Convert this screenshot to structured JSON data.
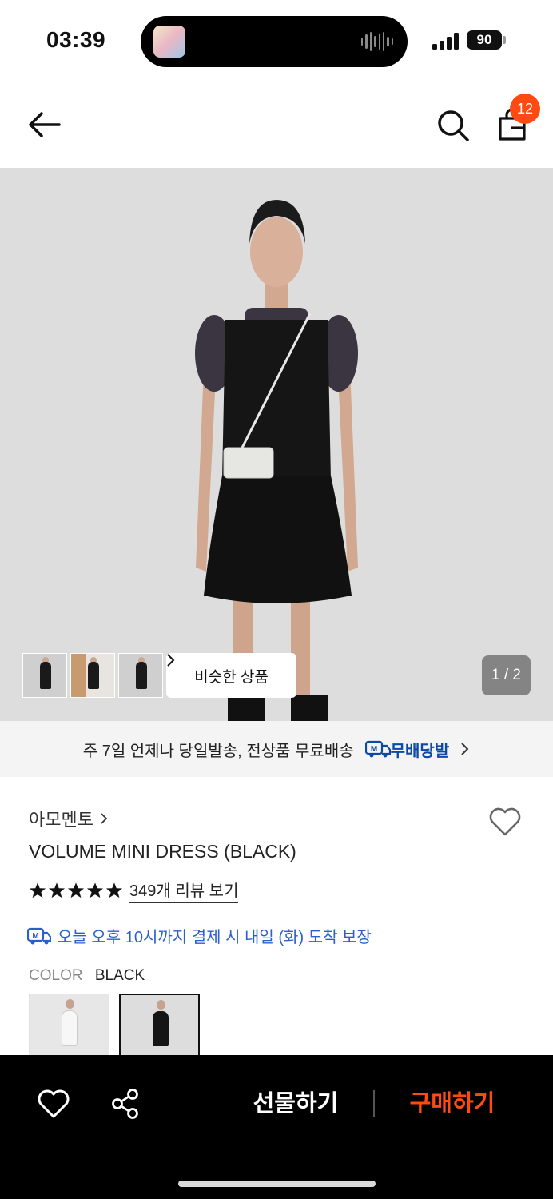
{
  "status_bar": {
    "time": "03:39",
    "battery": "90"
  },
  "header": {
    "cart_count": "12",
    "icons": [
      "back-arrow-icon",
      "search-icon",
      "shopping-bag-icon"
    ]
  },
  "hero": {
    "similar_button": "비슷한 상품",
    "page_indicator": "1 / 2",
    "thumbnail_count": 3,
    "background_color": "#dcdcdc"
  },
  "delivery_banner": {
    "text": "주 7일 언제나 당일발송, 전상품 무료배송",
    "badge": "무배당발",
    "badge_color": "#0c4aa6"
  },
  "product": {
    "brand": "아모멘토",
    "name": "VOLUME MINI DRESS (BLACK)",
    "rating_stars": 5,
    "review_link": "349개 리뷰 보기",
    "arrival_notice": "오늘 오후 10시까지 결제 시 내일 (화) 도착 보장",
    "color_label": "COLOR",
    "color_value": "BLACK"
  },
  "bottom_bar": {
    "gift": "선물하기",
    "buy": "구매하기",
    "buy_color": "#ff4b12"
  },
  "colors": {
    "accent": "#ff4b12",
    "link_blue": "#2c5fcc"
  }
}
